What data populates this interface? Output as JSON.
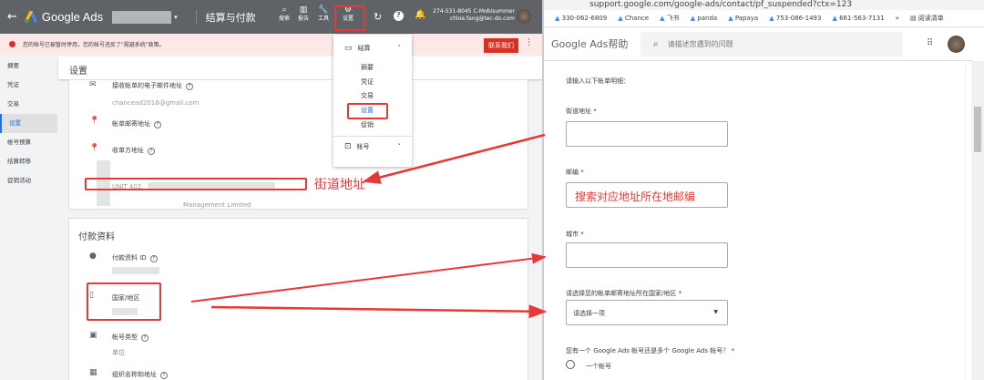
{
  "ads": {
    "brand": "Google Ads",
    "page_title": "结算与付款",
    "tools": [
      {
        "label": "搜索",
        "icon": "search-icon"
      },
      {
        "label": "报告",
        "icon": "reports-icon"
      },
      {
        "label": "工具",
        "icon": "wrench-icon"
      },
      {
        "label": "设置",
        "icon": "gear-icon"
      }
    ],
    "account_id": "274-531-8045 C-Mobisummer",
    "account_email": "chloe.fang@tec-do.com",
    "alert_text": "您的帐号已被暂时停用，您的帐号违反了\"规避系统\"政策。",
    "contact_button": "联系我们",
    "sidebar": [
      "摘要",
      "凭证",
      "交易",
      "设置",
      "帐号预算",
      "结算转移",
      "促销活动"
    ],
    "sidebar_active": 3,
    "section_title": "设置",
    "card1": {
      "email_label": "接收帐单的电子邮件地址",
      "email_value": "chancead2016@gmail.com",
      "mailing_label": "帐单邮寄地址",
      "payee_label": "收单方地址",
      "addr_line": "UNIT 402,",
      "company_suffix": "Management Limited"
    },
    "card2": {
      "title": "付款资料",
      "profile_id_label": "付款资料 ID",
      "country_label": "国家/地区",
      "account_type_label": "帐号类型",
      "account_type_value": "单位",
      "org_label": "组织名称和地址"
    },
    "menu": {
      "billing": "结算",
      "items": [
        "摘要",
        "凭证",
        "交易",
        "设置",
        "促销"
      ],
      "selected": 3,
      "account": "帐号"
    },
    "annotation_street": "街道地址"
  },
  "browser": {
    "url": "support.google.com/google-ads/contact/pf_suspended?ctx=123",
    "bookmarks": [
      "330-062-6809",
      "Chance",
      "飞书",
      "panda",
      "Papaya",
      "753-086-1493",
      "661-563-7131"
    ],
    "reading_list": "阅读清单"
  },
  "help": {
    "title": "Google Ads帮助",
    "search_placeholder": "请描述您遇到的问题",
    "intro": "请输入以下帐单明细：",
    "street_label": "街道地址 *",
    "postal_label": "邮编 *",
    "postal_annotation": "搜索对应地址所在地邮编",
    "city_label": "城市 *",
    "country_label": "请选择您的帐单邮寄地址所在国家/地区 *",
    "country_select": "请选择一项",
    "accounts_question": "您有一个 Google Ads 帐号还是多个 Google Ads 帐号？ *",
    "radio_one": "一个帐号"
  },
  "colors": {
    "annotation": "#e53935",
    "topbar": "#5f6368",
    "alert_bg": "#fce8e6"
  }
}
